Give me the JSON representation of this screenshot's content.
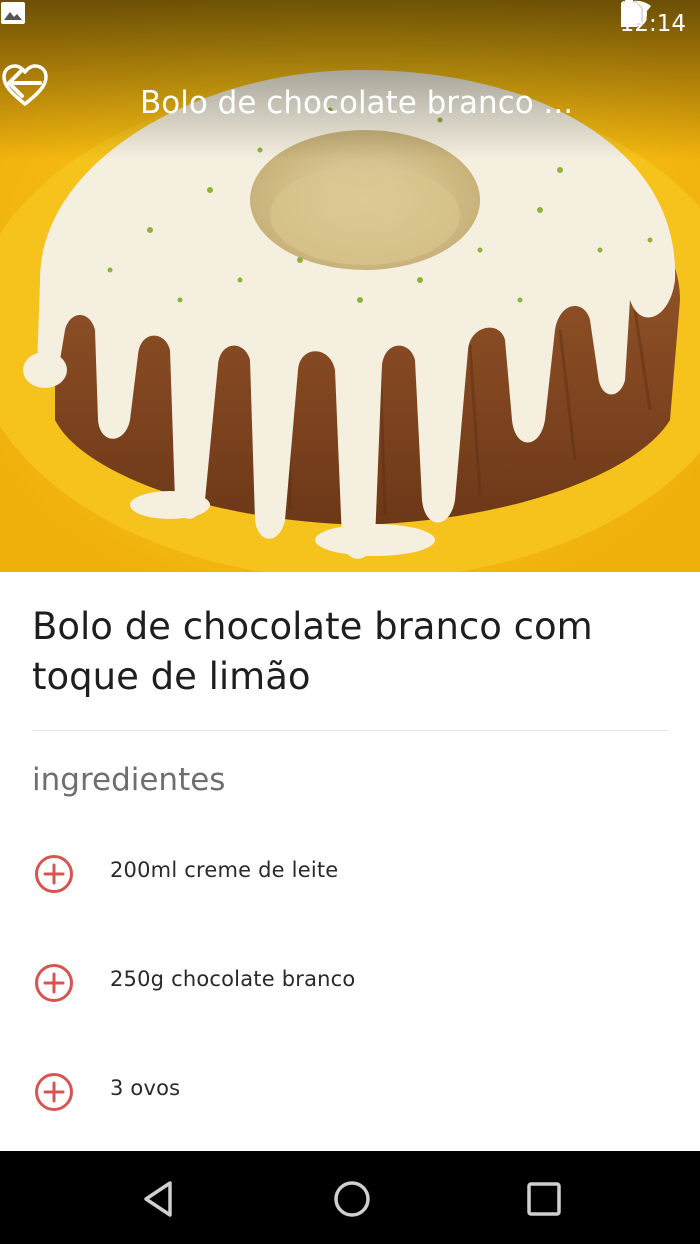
{
  "status_bar": {
    "time": "12:14",
    "icons": [
      "image-icon",
      "do-not-disturb-icon",
      "wifi-icon",
      "no-sim-icon",
      "battery-icon"
    ]
  },
  "app_bar": {
    "title": "Bolo de chocolate branco ...",
    "back_icon": "arrow-back-icon",
    "favorite_icon": "heart-outline-icon"
  },
  "recipe": {
    "title_line1": "Bolo de chocolate branco com",
    "title_line2": "toque de limão",
    "section_label": "ingredientes",
    "ingredients": [
      {
        "text": "200ml creme de leite"
      },
      {
        "text": "250g chocolate branco"
      },
      {
        "text": "3 ovos"
      }
    ]
  },
  "colors": {
    "accent": "#d9534f",
    "plate_yellow": "#f3b712",
    "glaze": "#f4efdf",
    "cake": "#8a4a24"
  },
  "nav_bar": {
    "icons": [
      "nav-back-icon",
      "nav-home-icon",
      "nav-recents-icon"
    ]
  }
}
